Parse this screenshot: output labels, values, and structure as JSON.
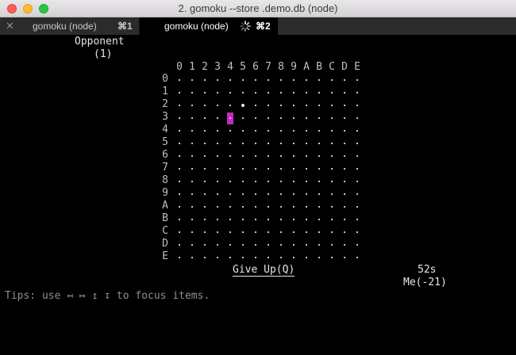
{
  "window": {
    "title": "2. gomoku --store .demo.db (node)"
  },
  "tabs": [
    {
      "label": "gomoku (node)",
      "shortcut": "⌘1",
      "active": false
    },
    {
      "label": "gomoku (node)",
      "shortcut": "⌘2",
      "active": true,
      "busy": true
    }
  ],
  "opponent": {
    "name": "Opponent",
    "score": "(1)"
  },
  "board": {
    "columns": [
      "0",
      "1",
      "2",
      "3",
      "4",
      "5",
      "6",
      "7",
      "8",
      "9",
      "A",
      "B",
      "C",
      "D",
      "E"
    ],
    "rows": [
      "0",
      "1",
      "2",
      "3",
      "4",
      "5",
      "6",
      "7",
      "8",
      "9",
      "A",
      "B",
      "C",
      "D",
      "E"
    ],
    "stones": [
      {
        "row": "2",
        "col": "5",
        "color": "white"
      }
    ],
    "cursor": {
      "row": "3",
      "col": "4"
    }
  },
  "controls": {
    "give_up_label": "Give Up(Q)"
  },
  "status": {
    "timer": "52s",
    "me_score": "Me(-21)"
  },
  "tips": "Tips: use ↤ ↦ ↥ ↧ to focus items.",
  "colors": {
    "cursor": "#c22bc2",
    "background": "#000000",
    "text": "#e6e6e6"
  }
}
